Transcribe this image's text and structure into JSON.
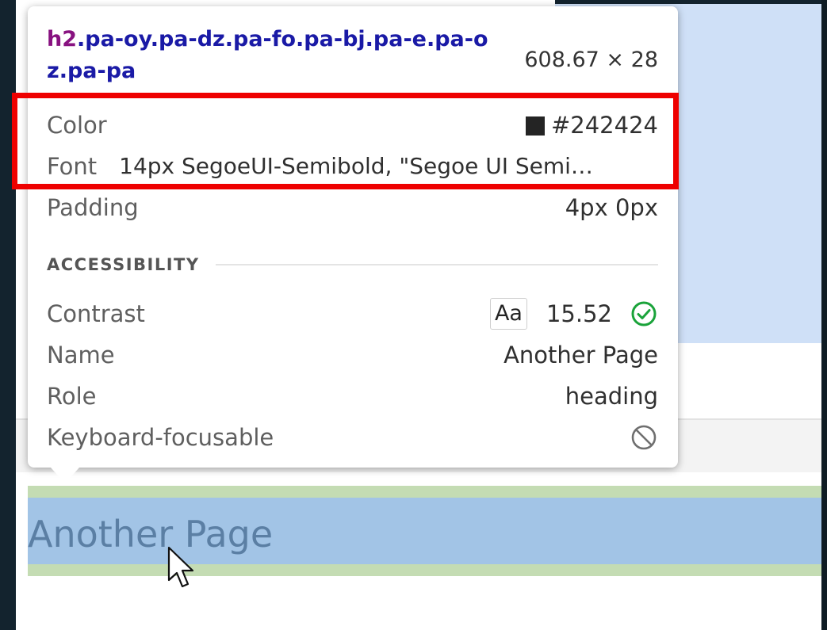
{
  "tooltip": {
    "tag": "h2",
    "classes": ".pa-oy.pa-dz.pa-fo.pa-bj.pa-e.pa-oz.pa-pa",
    "size": "608.67 × 28",
    "color_label": "Color",
    "color_value": "#242424",
    "font_label": "Font",
    "font_value": "14px SegoeUI-Semibold, \"Segoe UI Semi…",
    "padding_label": "Padding",
    "padding_value": "4px 0px",
    "accessibility_header": "ACCESSIBILITY",
    "contrast_label": "Contrast",
    "contrast_sample": "Aa",
    "contrast_value": "15.52",
    "name_label": "Name",
    "name_value": "Another Page",
    "role_label": "Role",
    "role_value": "heading",
    "keyboard_label": "Keyboard-focusable"
  },
  "page": {
    "heading": "Another Page"
  },
  "colors": {
    "highlight_outline": "#ee0000",
    "swatch": "#242424",
    "pass_check": "#1aa33a",
    "heading_content_bg": "#a2c4e6",
    "heading_margin_bg": "#c4dcb3"
  },
  "icons": {
    "contrast_status": "check-circle-icon",
    "keyboard_status": "not-allowed-icon",
    "pointer": "mouse-cursor-icon"
  }
}
